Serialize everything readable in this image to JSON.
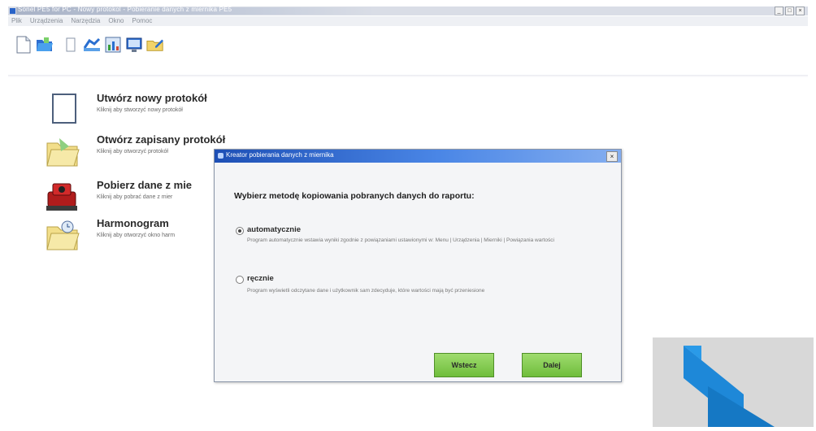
{
  "window": {
    "title": "Sonel PE5 for PC - Nowy protokol - Pobieranie danych z miernika PE5 ",
    "controls": [
      "_",
      "□",
      "×"
    ]
  },
  "menu": [
    "Plik",
    "Urządzenia",
    "Narzędzia",
    "Okno",
    "Pomoc"
  ],
  "toolbar_icons": [
    "new-document-icon",
    "open-folder-icon",
    "copy-icon",
    "meter-icon",
    "chart-icon",
    "monitor-icon",
    "folder-edit-icon"
  ],
  "actions": [
    {
      "title": "Utwórz nowy protokół",
      "subtitle": "Kliknij aby stworzyć nowy protokół"
    },
    {
      "title": "Otwórz zapisany protokół",
      "subtitle": "Kliknij aby otworzyć protokół"
    },
    {
      "title": "Pobierz dane z mie",
      "subtitle": "Kliknij aby pobrać dane z mier"
    },
    {
      "title": "Harmonogram",
      "subtitle": "Kliknij aby otworzyć okno harm"
    }
  ],
  "dialog": {
    "title": "Kreator pobierania danych z miernika",
    "close": "×",
    "heading": "Wybierz metodę kopiowania pobranych danych do raportu:",
    "options": [
      {
        "label": "automatycznie",
        "selected": true,
        "description": "Program automatycznie wstawia wyniki zgodnie z powiązaniami ustawionymi w: Menu | Urządzenia | Mierniki | Powiązania wartości"
      },
      {
        "label": "ręcznie",
        "selected": false,
        "description": "Program wyświetli odczytane dane i użytkownik sam zdecyduje, które wartości mają być przeniesione"
      }
    ],
    "back_button": "Wstecz",
    "next_button": "Dalej"
  },
  "colors": {
    "dialog_title_start": "#1d4fb5",
    "dialog_title_end": "#84aef0",
    "button_green": "#7cc64a",
    "logo_blue": "#1e88d8"
  }
}
